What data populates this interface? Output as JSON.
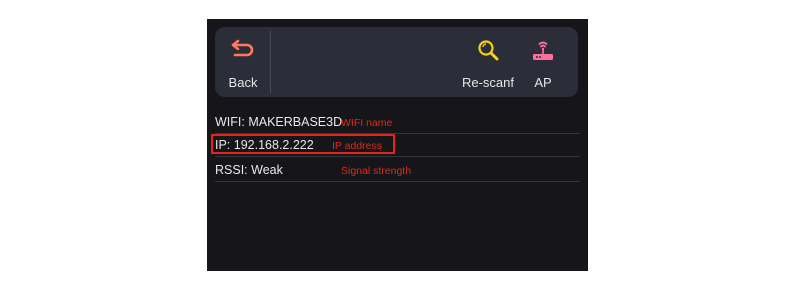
{
  "toolbar": {
    "back_label": "Back",
    "rescan_label": "Re-scanf",
    "ap_label": "AP"
  },
  "info": {
    "wifi": {
      "text": "WIFI: MAKERBASE3D",
      "annotation": "WIFI name"
    },
    "ip": {
      "text": "IP: 192.168.2.222",
      "annotation": "IP address"
    },
    "rssi": {
      "text": "RSSI: Weak",
      "annotation": "Signal strength"
    }
  },
  "colors": {
    "screen_bg": "#16161a",
    "toolbar_bg": "#2b2e38",
    "back_icon": "#ff7a5a",
    "search_icon": "#f2d21b",
    "router_icon": "#ff6fa0",
    "annotation": "#e0261c"
  },
  "icons": {
    "back": "return-arrow-icon",
    "rescan": "magnifier-icon",
    "ap": "router-icon"
  }
}
